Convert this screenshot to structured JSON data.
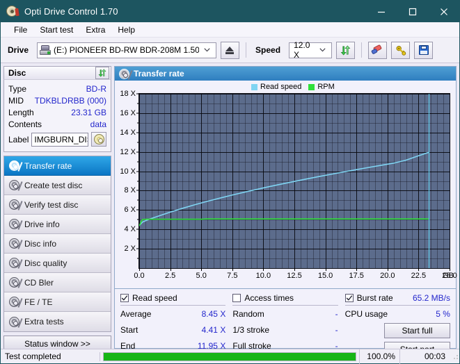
{
  "window": {
    "title": "Opti Drive Control 1.70",
    "icon": "disc-icon",
    "minimize": "minimize-icon",
    "maximize": "maximize-icon",
    "close": "close-icon",
    "titlebar_color": "#1d5560"
  },
  "menu": {
    "items": [
      {
        "label": "File"
      },
      {
        "label": "Start test"
      },
      {
        "label": "Extra"
      },
      {
        "label": "Help"
      }
    ]
  },
  "toolbar": {
    "drive_label": "Drive",
    "drive_value": "(E:)  PIONEER BD-RW   BDR-208M 1.50",
    "drive_icon": "drive-icon",
    "eject_icon": "eject-icon",
    "speed_label": "Speed",
    "speed_value": "12.0 X",
    "refresh_icon": "refresh-icon",
    "erase_icon": "eraser-icon",
    "key_icon": "key-icon",
    "save_icon": "save-icon",
    "caret": "∨"
  },
  "disc_panel": {
    "title": "Disc",
    "refresh_icon": "refresh-icon",
    "rows": [
      {
        "key": "Type",
        "value": "BD-R"
      },
      {
        "key": "MID",
        "value": "TDKBLDRBB (000)"
      },
      {
        "key": "Length",
        "value": "23.31 GB"
      },
      {
        "key": "Contents",
        "value": "data"
      }
    ],
    "label_key": "Label",
    "label_value": "IMGBURN_DIS",
    "label_button_icon": "disc-icon"
  },
  "nav": {
    "items": [
      {
        "label": "Transfer rate",
        "active": true
      },
      {
        "label": "Create test disc",
        "active": false
      },
      {
        "label": "Verify test disc",
        "active": false
      },
      {
        "label": "Drive info",
        "active": false
      },
      {
        "label": "Disc info",
        "active": false
      },
      {
        "label": "Disc quality",
        "active": false
      },
      {
        "label": "CD Bler",
        "active": false
      },
      {
        "label": "FE / TE",
        "active": false
      },
      {
        "label": "Extra tests",
        "active": false
      }
    ],
    "status_window_button": "Status window >>"
  },
  "chart_panel": {
    "title": "Transfer rate",
    "icon": "disc-icon"
  },
  "chart_data": {
    "type": "line",
    "title": "Transfer rate",
    "xlabel": "GB",
    "ylabel": "X",
    "xlim": [
      0,
      25
    ],
    "ylim": [
      0,
      18
    ],
    "grid": true,
    "legend_position": "top-left",
    "xticks": [
      0.0,
      2.5,
      5.0,
      7.5,
      10.0,
      12.5,
      15.0,
      17.5,
      20.0,
      22.5,
      25.0
    ],
    "xtick_labels": [
      "0.0",
      "2.5",
      "5.0",
      "7.5",
      "10.0",
      "12.5",
      "15.0",
      "17.5",
      "20.0",
      "22.5",
      "25.0"
    ],
    "x_unit_label": "GB",
    "yticks": [
      2,
      4,
      6,
      8,
      10,
      12,
      14,
      16,
      18
    ],
    "ytick_labels": [
      "2 X",
      "4 X",
      "6 X",
      "8 X",
      "10 X",
      "12 X",
      "14 X",
      "16 X",
      "18 X"
    ],
    "marker_x": 23.31,
    "series": [
      {
        "name": "Read speed",
        "color": "#7fd4f2",
        "x": [
          0.0,
          0.3,
          0.8,
          1.5,
          2.5,
          3.5,
          4.5,
          5.5,
          6.5,
          7.5,
          8.5,
          9.5,
          10.5,
          11.5,
          12.5,
          13.5,
          14.5,
          15.5,
          16.5,
          17.5,
          18.5,
          19.5,
          20.5,
          21.5,
          22.5,
          23.31
        ],
        "values": [
          4.41,
          4.78,
          5.05,
          5.35,
          5.78,
          6.18,
          6.55,
          6.9,
          7.23,
          7.55,
          7.85,
          8.14,
          8.42,
          8.69,
          8.95,
          9.21,
          9.46,
          9.7,
          9.94,
          10.17,
          10.4,
          10.62,
          10.84,
          11.15,
          11.6,
          11.95
        ]
      },
      {
        "name": "RPM",
        "color": "#2fe03a",
        "x": [
          0.0,
          0.25,
          0.6,
          1.2,
          5.0,
          5.4,
          10.0,
          15.0,
          20.0,
          21.5,
          23.31
        ],
        "values": [
          4.35,
          5.02,
          5.05,
          5.05,
          5.05,
          5.08,
          5.08,
          5.08,
          5.08,
          5.08,
          5.08
        ]
      }
    ]
  },
  "results": {
    "read_speed": {
      "checked": true,
      "title": "Read speed",
      "rows": [
        {
          "key": "Average",
          "value": "8.45 X"
        },
        {
          "key": "Start",
          "value": "4.41 X"
        },
        {
          "key": "End",
          "value": "11.95 X"
        }
      ]
    },
    "access_times": {
      "checked": false,
      "title": "Access times",
      "rows": [
        {
          "key": "Random",
          "value": "-"
        },
        {
          "key": "1/3 stroke",
          "value": "-"
        },
        {
          "key": "Full stroke",
          "value": "-"
        }
      ]
    },
    "burst_rate": {
      "checked": true,
      "title": "Burst rate",
      "value": "65.2 MB/s",
      "rows": [
        {
          "key": "CPU usage",
          "value": "5 %"
        }
      ],
      "buttons": [
        {
          "label": "Start full"
        },
        {
          "label": "Start part"
        }
      ]
    }
  },
  "statusbar": {
    "message": "Test completed",
    "progress_percent": 100.0,
    "progress_text": "100.0%",
    "elapsed": "00:03",
    "progress_color": "#16b516"
  }
}
